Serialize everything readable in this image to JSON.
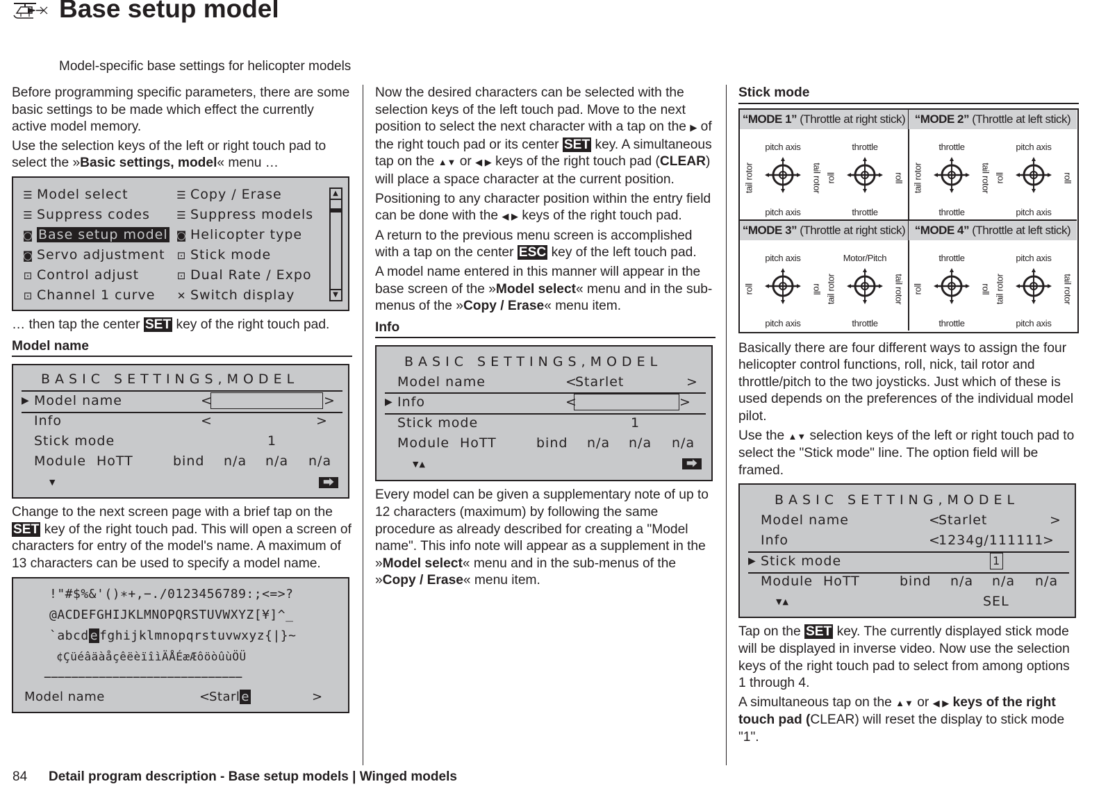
{
  "header": {
    "icon": "helicopter-icon",
    "title": "Base setup model",
    "subtitle": "Model-specific base settings for helicopter models"
  },
  "col1": {
    "p1": "Before programming specific parameters, there are some basic settings to be made which effect the currently active model memory.",
    "p2_pre": "Use the selection keys of the left or right touch pad to select the »",
    "p2_bold": "Basic settings, model",
    "p2_post": "« menu …",
    "menu_screen": {
      "left": [
        {
          "icon": "list-icon",
          "label": "Model select"
        },
        {
          "icon": "list-icon",
          "label": "Suppress codes"
        },
        {
          "icon": "heli-model-icon",
          "label": "Base setup model",
          "selected": true
        },
        {
          "icon": "heli-model-icon",
          "label": "Servo adjustment"
        },
        {
          "icon": "stick-icon",
          "label": "Control adjust"
        },
        {
          "icon": "stick-icon",
          "label": "Channel 1 curve"
        }
      ],
      "right": [
        {
          "icon": "list-icon",
          "label": "Copy / Erase"
        },
        {
          "icon": "list-icon",
          "label": "Suppress models"
        },
        {
          "icon": "heli-model-icon",
          "label": "Helicopter type"
        },
        {
          "icon": "stick-icon",
          "label": "Stick mode"
        },
        {
          "icon": "stick-icon",
          "label": "Dual Rate / Expo"
        },
        {
          "icon": "switch-icon",
          "label": "Switch display"
        }
      ]
    },
    "p3_pre": "… then tap the center ",
    "p3_key": "SET",
    "p3_post": " key of the right touch pad.",
    "model_name_heading": "Model name",
    "screen1": {
      "title": "BASIC SETTINGS,MODEL",
      "model_name_label": "Model name",
      "model_name_value": "",
      "info_label": "Info",
      "info_value": "",
      "stick_mode_label": "Stick mode",
      "stick_mode_value": "1",
      "module_label": "Module",
      "module_value": "HoTT",
      "bind": "bind",
      "na1": "n/a",
      "na2": "n/a",
      "na3": "n/a",
      "nav": "▼",
      "next": "⮕"
    },
    "p4_pre": "Change to the next screen page with a brief tap on the ",
    "p4_key": "SET",
    "p4_post": " key of the right touch pad. This will open a screen of characters for entry of the model's name. A maximum of 13 characters can be used to specify a model name.",
    "charset_screen": {
      "row1": "!\"#$%&'()∗+,−./0123456789:;<=>?",
      "row2": "@ACDEFGHIJKLMNOPQRSTUVWXYZ[¥]^_",
      "row3_pre": "`abcd",
      "row3_hl": "e",
      "row3_post": "fghijklmnopqrstuvwxyz{|}~",
      "row4": "¢ÇüéâäàåçêëèïîìÄÅÉæÆôöòûùÖÜ",
      "dashes": "−−−−−−−−−−−−−−−−−−−−−−−−−−−−−",
      "label": "Model name",
      "value_pre": "Starl",
      "value_hl": "e"
    }
  },
  "col2": {
    "p1_a": "Now the desired characters can be selected with the selection keys of the left touch pad. Move to the next position to select the next character with a tap on the ",
    "p1_b": " of the right touch pad or its center ",
    "p1_key": "SET",
    "p1_c": " key. A simultaneous tap on the ",
    "p1_d": " or ",
    "p1_e": " keys of the right touch pad (",
    "p1_bold": "CLEAR",
    "p1_f": ") will place a space character at the current position.",
    "p2_a": "Positioning to any character position within the entry field can be done with the ",
    "p2_b": " keys of the right touch pad.",
    "p3_a": "A return to the previous menu screen is accomplished with a tap on the center ",
    "p3_key": "ESC",
    "p3_b": " key of the left touch pad.",
    "p4_a": "A model name entered in this manner will appear in the base screen of the »",
    "p4_bold1": "Model select",
    "p4_b": "« menu and in the sub-menus of the »",
    "p4_bold2": "Copy / Erase",
    "p4_c": "« menu item.",
    "info_heading": "Info",
    "screen2": {
      "title": "BASIC SETTINGS,MODEL",
      "model_name_label": "Model name",
      "model_name_value": "Starlet",
      "info_label": "Info",
      "info_value": "",
      "stick_mode_label": "Stick mode",
      "stick_mode_value": "1",
      "module_label": "Module",
      "module_value": "HoTT",
      "bind": "bind",
      "na1": "n/a",
      "na2": "n/a",
      "na3": "n/a",
      "nav": "▼▲",
      "next": "⮕"
    },
    "p5_a": "Every model can be given a supplementary note of up to 12 characters (maximum) by following the same procedure as already described for creating a \"Model name\". This info note will appear as a supplement in the »",
    "p5_bold1": "Model select",
    "p5_b": "« menu and in the sub-menus of the »",
    "p5_bold2": "Copy / Erase",
    "p5_c": "« menu item."
  },
  "col3": {
    "stick_heading": "Stick mode",
    "modes": [
      {
        "name": "“MODE 1”",
        "desc": " (Throttle at right stick)",
        "left": {
          "top": "pitch axis",
          "bottom": "pitch axis",
          "l": "tail rotor",
          "r": "tail rotor"
        },
        "right": {
          "top": "throttle",
          "bottom": "throttle",
          "l": "roll",
          "r": "roll"
        }
      },
      {
        "name": "“MODE 2”",
        "desc": " (Throttle at left stick)",
        "left": {
          "top": "throttle",
          "bottom": "throttle",
          "l": "tail rotor",
          "r": "tail rotor"
        },
        "right": {
          "top": "pitch axis",
          "bottom": "pitch axis",
          "l": "roll",
          "r": "roll"
        }
      },
      {
        "name": "“MODE 3”",
        "desc": " (Throttle at right stick)",
        "left": {
          "top": "pitch axis",
          "bottom": "pitch axis",
          "l": "roll",
          "r": "roll"
        },
        "right": {
          "top": "Motor/Pitch",
          "bottom": "throttle",
          "l": "tail rotor",
          "r": "tail rotor"
        }
      },
      {
        "name": "“MODE 4”",
        "desc": " (Throttle at left stick)",
        "left": {
          "top": "throttle",
          "bottom": "throttle",
          "l": "roll",
          "r": "roll"
        },
        "right": {
          "top": "pitch axis",
          "bottom": "pitch axis",
          "l": "tail rotor",
          "r": "tail rotor"
        }
      }
    ],
    "p1": "Basically there are four different ways to assign the four helicopter control functions, roll, nick, tail rotor and throttle/pitch to the two joysticks. Just which of these is used depends on the preferences of the individual model pilot.",
    "p2_a": "Use the ",
    "p2_b": " selection keys of the left or right touch pad to select the \"Stick mode\" line. The option field will be framed.",
    "screen3": {
      "title": "BASIC SETTING,MODEL",
      "model_name_label": "Model name",
      "model_name_value": "Starlet",
      "info_label": "Info",
      "info_value": "1234g/111111",
      "stick_mode_label": "Stick mode",
      "stick_mode_value": "1",
      "module_label": "Module",
      "module_value": "HoTT",
      "bind": "bind",
      "na1": "n/a",
      "na2": "n/a",
      "na3": "n/a",
      "nav": "▼▲",
      "sel": "SEL"
    },
    "p3_a": "Tap on the ",
    "p3_key": "SET",
    "p3_b": " key. The currently displayed stick mode will be displayed in inverse video. Now use the selection keys of the right touch pad to select from among options 1 through 4.",
    "p4_a": "A simultaneous tap on the ",
    "p4_b": " or ",
    "p4_bold": " keys of the right touch pad (",
    "p4_c": "CLEAR) will reset the display to stick mode \"1\"."
  },
  "glyphs": {
    "right": "▶",
    "updown": "▲▼",
    "leftright": "◀ ▶"
  },
  "footer": {
    "page_number": "84",
    "text": "Detail program description - Base setup models | Winged models"
  }
}
